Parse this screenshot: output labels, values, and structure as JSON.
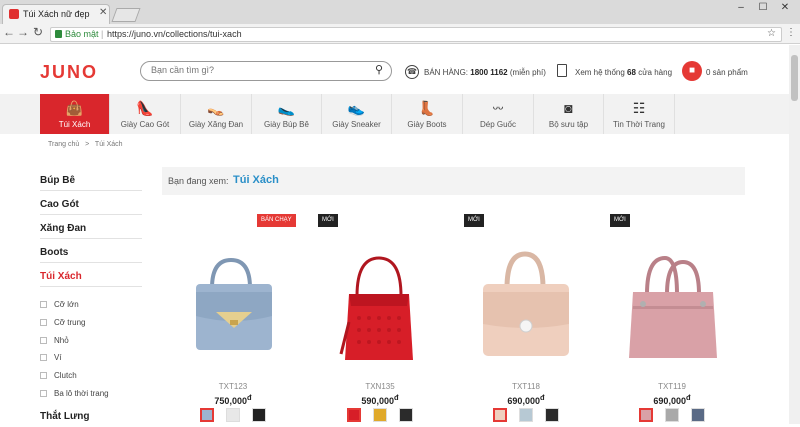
{
  "browser": {
    "tab_title": "Túi Xách nữ đẹp",
    "secure_label": "Bảo mật",
    "url": "https://juno.vn/collections/tui-xach"
  },
  "header": {
    "logo": "JUNO",
    "search_placeholder": "Bạn cần tìm gì?",
    "hotline_label": "BÁN HÀNG:",
    "hotline_number": "1800 1162",
    "hotline_note": "(miễn phí)",
    "stores_prefix": "Xem hệ thống",
    "stores_count": "68",
    "stores_suffix": "cửa hàng",
    "cart_label": "0 sản phẩm"
  },
  "nav": [
    {
      "label": "Túi Xách",
      "icon": "handbag-icon",
      "active": true
    },
    {
      "label": "Giày Cao Gót",
      "icon": "high-heel-icon"
    },
    {
      "label": "Giày Xăng Đan",
      "icon": "sandal-icon"
    },
    {
      "label": "Giày Búp Bê",
      "icon": "flat-shoe-icon"
    },
    {
      "label": "Giày Sneaker",
      "icon": "sneaker-icon"
    },
    {
      "label": "Giày Boots",
      "icon": "boot-icon"
    },
    {
      "label": "Dép Guốc",
      "icon": "flip-flop-icon"
    },
    {
      "label": "Bộ sưu tập",
      "icon": "camera-icon"
    },
    {
      "label": "Tin Thời Trang",
      "icon": "news-icon"
    }
  ],
  "breadcrumb": {
    "home": "Trang chủ",
    "sep": ">",
    "current": "Túi Xách"
  },
  "sidebar": {
    "categories": [
      "Búp Bê",
      "Cao Gót",
      "Xăng Đan",
      "Boots",
      "Túi Xách"
    ],
    "subcategories": [
      "Cỡ lớn",
      "Cỡ trung",
      "Nhỏ",
      "Ví",
      "Clutch",
      "Ba lô thời trang"
    ],
    "after": "Thắt Lưng"
  },
  "current": {
    "label": "Bạn đang xem:",
    "value": "Túi Xách"
  },
  "products": [
    {
      "badge": "BÁN CHẠY",
      "code": "TXT123",
      "price": "750,000",
      "currency": "đ",
      "colors": [
        "#9db4cf",
        "#e8e8e8",
        "#222222"
      ]
    },
    {
      "badge": "MỚI",
      "code": "TXN135",
      "price": "590,000",
      "currency": "đ",
      "colors": [
        "#d71e28",
        "#e0a92a",
        "#2b2b2b"
      ]
    },
    {
      "badge": "MỚI",
      "code": "TXT118",
      "price": "690,000",
      "currency": "đ",
      "colors": [
        "#efcfbe",
        "#b7c9d4",
        "#2b2b2b"
      ]
    },
    {
      "badge": "MỚI",
      "code": "TXT119",
      "price": "690,000",
      "currency": "đ",
      "colors": [
        "#d9a1a7",
        "#a9a9a9",
        "#5a6a85"
      ]
    }
  ]
}
